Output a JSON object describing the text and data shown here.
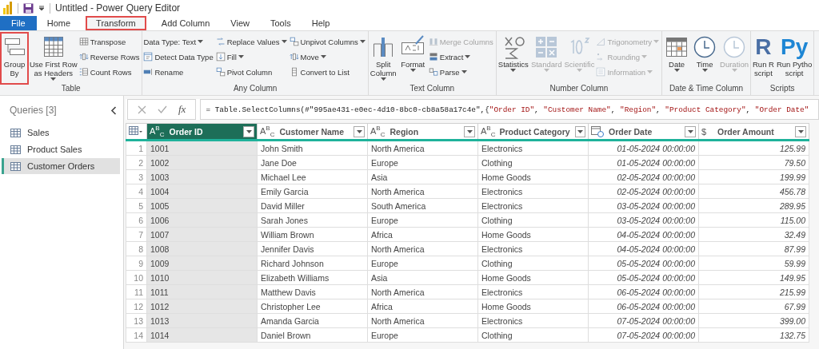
{
  "window": {
    "title": "Untitled - Power Query Editor"
  },
  "tabs": [
    {
      "label": "File",
      "kind": "file",
      "selected": false,
      "highlighted": false
    },
    {
      "label": "Home",
      "kind": "tab",
      "selected": false,
      "highlighted": false
    },
    {
      "label": "Transform",
      "kind": "tab",
      "selected": true,
      "highlighted": true
    },
    {
      "label": "Add Column",
      "kind": "tab",
      "selected": false,
      "highlighted": false
    },
    {
      "label": "View",
      "kind": "tab",
      "selected": false,
      "highlighted": false
    },
    {
      "label": "Tools",
      "kind": "tab",
      "selected": false,
      "highlighted": false
    },
    {
      "label": "Help",
      "kind": "tab",
      "selected": false,
      "highlighted": false
    }
  ],
  "ribbon": [
    {
      "label": "Table",
      "items": [
        {
          "kind": "large",
          "label": "Group\nBy",
          "dropdown": false,
          "disabled": false,
          "highlighted": true
        },
        {
          "kind": "large",
          "label": "Use First Row\nas Headers",
          "dropdown": true,
          "disabled": false,
          "highlighted": false
        },
        {
          "kind": "stack",
          "items": [
            {
              "label": "Transpose",
              "dropdown": false,
              "disabled": false
            },
            {
              "label": "Reverse Rows",
              "dropdown": false,
              "disabled": false
            },
            {
              "label": "Count Rows",
              "dropdown": false,
              "disabled": false
            }
          ]
        }
      ]
    },
    {
      "label": "Any Column",
      "items": [
        {
          "kind": "stack",
          "items": [
            {
              "label": "Data Type: Text",
              "dropdown": true,
              "disabled": false
            },
            {
              "label": "Detect Data Type",
              "dropdown": false,
              "disabled": false
            },
            {
              "label": "Rename",
              "dropdown": false,
              "disabled": false
            }
          ]
        },
        {
          "kind": "stack",
          "items": [
            {
              "label": "Replace Values",
              "dropdown": true,
              "disabled": false
            },
            {
              "label": "Fill",
              "dropdown": true,
              "disabled": false
            },
            {
              "label": "Pivot Column",
              "dropdown": false,
              "disabled": false
            }
          ]
        },
        {
          "kind": "stack",
          "items": [
            {
              "label": "Unpivot Columns",
              "dropdown": true,
              "disabled": false
            },
            {
              "label": "Move",
              "dropdown": true,
              "disabled": false
            },
            {
              "label": "Convert to List",
              "dropdown": false,
              "disabled": false
            }
          ]
        }
      ]
    },
    {
      "label": "Text Column",
      "items": [
        {
          "kind": "large",
          "label": "Split\nColumn",
          "dropdown": true,
          "disabled": false,
          "highlighted": false
        },
        {
          "kind": "large",
          "label": "Format",
          "dropdown": true,
          "disabled": false,
          "highlighted": false
        },
        {
          "kind": "stack",
          "items": [
            {
              "label": "Merge Columns",
              "dropdown": false,
              "disabled": true
            },
            {
              "label": "Extract",
              "dropdown": true,
              "disabled": false
            },
            {
              "label": "Parse",
              "dropdown": true,
              "disabled": false
            }
          ]
        }
      ]
    },
    {
      "label": "Number Column",
      "items": [
        {
          "kind": "large",
          "label": "Statistics",
          "dropdown": true,
          "disabled": false,
          "highlighted": false
        },
        {
          "kind": "large",
          "label": "Standard",
          "dropdown": true,
          "disabled": true,
          "highlighted": false
        },
        {
          "kind": "large",
          "label": "Scientific",
          "dropdown": true,
          "disabled": true,
          "highlighted": false
        },
        {
          "kind": "stack",
          "items": [
            {
              "label": "Trigonometry",
              "dropdown": true,
              "disabled": true
            },
            {
              "label": "Rounding",
              "dropdown": true,
              "disabled": true
            },
            {
              "label": "Information",
              "dropdown": true,
              "disabled": true
            }
          ]
        }
      ]
    },
    {
      "label": "Date & Time Column",
      "items": [
        {
          "kind": "large",
          "label": "Date",
          "dropdown": true,
          "disabled": false,
          "highlighted": false
        },
        {
          "kind": "large",
          "label": "Time",
          "dropdown": true,
          "disabled": false,
          "highlighted": false
        },
        {
          "kind": "large",
          "label": "Duration",
          "dropdown": true,
          "disabled": true,
          "highlighted": false
        }
      ]
    },
    {
      "label": "Scripts",
      "items": [
        {
          "kind": "large",
          "label": "Run R\nscript",
          "icon_text": "R",
          "dropdown": false,
          "disabled": false,
          "highlighted": false
        },
        {
          "kind": "large",
          "label": "Run Pytho\nscript",
          "icon_text": "Py",
          "dropdown": false,
          "disabled": false,
          "highlighted": false
        }
      ]
    }
  ],
  "queries": {
    "title": "Queries [3]",
    "items": [
      {
        "label": "Sales",
        "selected": false
      },
      {
        "label": "Product Sales",
        "selected": false
      },
      {
        "label": "Customer Orders",
        "selected": true
      }
    ]
  },
  "formula": [
    {
      "kind": "plain",
      "text": "= Table.SelectColumns(#\"995ae431-e0ec-4d10-8bc0-cb8a58a17c4e\",{"
    },
    {
      "kind": "string",
      "text": "\"Order ID\""
    },
    {
      "kind": "plain",
      "text": ", "
    },
    {
      "kind": "string",
      "text": "\"Customer Name\""
    },
    {
      "kind": "plain",
      "text": ", "
    },
    {
      "kind": "string",
      "text": "\"Region\""
    },
    {
      "kind": "plain",
      "text": ", "
    },
    {
      "kind": "string",
      "text": "\"Product Category\""
    },
    {
      "kind": "plain",
      "text": ", "
    },
    {
      "kind": "string",
      "text": "\"Order Date\""
    }
  ],
  "fx": "fx",
  "table": {
    "columns": [
      {
        "name": "Order ID",
        "kind": "text",
        "glyph": "A$^{B}$$_{C}$",
        "selected": true
      },
      {
        "name": "Customer Name",
        "kind": "text",
        "glyph": "A$^{B}$$_{C}$",
        "selected": false
      },
      {
        "name": "Region",
        "kind": "text",
        "glyph": "A$^{B}$$_{C}$",
        "selected": false
      },
      {
        "name": "Product Category",
        "kind": "text",
        "glyph": "A$^{B}$$_{C}$",
        "selected": false
      },
      {
        "name": "Order Date",
        "kind": "date",
        "selected": false
      },
      {
        "name": "Order Amount",
        "kind": "currency",
        "glyph": "$",
        "selected": false
      }
    ],
    "rows": [
      {
        "number": "1",
        "cells": [
          "1001",
          "John Smith",
          "North America",
          "Electronics",
          "01-05-2024 00:00:00",
          "125.99"
        ]
      },
      {
        "number": "2",
        "cells": [
          "1002",
          "Jane Doe",
          "Europe",
          "Clothing",
          "01-05-2024 00:00:00",
          "79.50"
        ]
      },
      {
        "number": "3",
        "cells": [
          "1003",
          "Michael Lee",
          "Asia",
          "Home Goods",
          "02-05-2024 00:00:00",
          "199.99"
        ]
      },
      {
        "number": "4",
        "cells": [
          "1004",
          "Emily Garcia",
          "North America",
          "Electronics",
          "02-05-2024 00:00:00",
          "456.78"
        ]
      },
      {
        "number": "5",
        "cells": [
          "1005",
          "David Miller",
          "South America",
          "Electronics",
          "03-05-2024 00:00:00",
          "289.95"
        ]
      },
      {
        "number": "6",
        "cells": [
          "1006",
          "Sarah Jones",
          "Europe",
          "Clothing",
          "03-05-2024 00:00:00",
          "115.00"
        ]
      },
      {
        "number": "7",
        "cells": [
          "1007",
          "William Brown",
          "Africa",
          "Home Goods",
          "04-05-2024 00:00:00",
          "32.49"
        ]
      },
      {
        "number": "8",
        "cells": [
          "1008",
          "Jennifer Davis",
          "North America",
          "Electronics",
          "04-05-2024 00:00:00",
          "87.99"
        ]
      },
      {
        "number": "9",
        "cells": [
          "1009",
          "Richard Johnson",
          "Europe",
          "Clothing",
          "05-05-2024 00:00:00",
          "59.99"
        ]
      },
      {
        "number": "10",
        "cells": [
          "1010",
          "Elizabeth Williams",
          "Asia",
          "Home Goods",
          "05-05-2024 00:00:00",
          "149.95"
        ]
      },
      {
        "number": "11",
        "cells": [
          "1011",
          "Matthew Davis",
          "North America",
          "Electronics",
          "06-05-2024 00:00:00",
          "215.99"
        ]
      },
      {
        "number": "12",
        "cells": [
          "1012",
          "Christopher Lee",
          "Africa",
          "Home Goods",
          "06-05-2024 00:00:00",
          "67.99"
        ]
      },
      {
        "number": "13",
        "cells": [
          "1013",
          "Amanda Garcia",
          "North America",
          "Electronics",
          "07-05-2024 00:00:00",
          "399.00"
        ]
      },
      {
        "number": "14",
        "cells": [
          "1014",
          "Daniel Brown",
          "Europe",
          "Clothing",
          "07-05-2024 00:00:00",
          "132.75"
        ]
      }
    ]
  }
}
